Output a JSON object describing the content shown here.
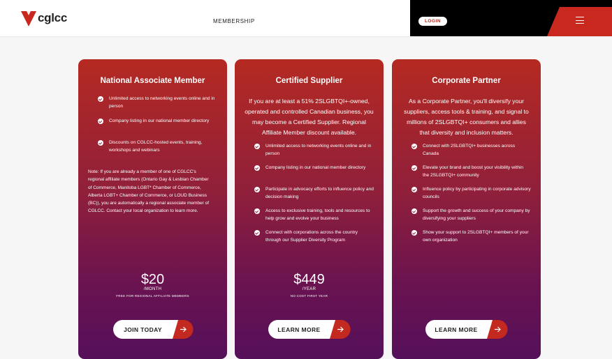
{
  "header": {
    "logo_text": "cglcc",
    "nav_membership": "MEMBERSHIP",
    "login_label": "LOGIN"
  },
  "colors": {
    "accent": "#b22a1d",
    "card_top": "#b52a22",
    "card_bottom": "#55105a"
  },
  "cards": [
    {
      "title": "National Associate Member",
      "features": [
        "Unlimited access to networking events online and in person",
        "Company listing in our national member directory",
        "Discounts on CGLCC-hosted events, training, workshops and webinars"
      ],
      "note": "Note: If you are already a member of one of CGLCC's regional affiliate members (Ontario Gay & Lesbian Chamber of Commerce, Manitoba LGBT* Chamber of Commerce, Alberta LGBT+ Chamber of Commerce, or LOUD Business (BC)), you are automatically a regional associate member of CGLCC. Contact your local organization to learn more.",
      "price": "$20",
      "period": "/MONTH",
      "price_note": "FREE FOR REGIONAL AFFILIATE MEMBERS",
      "cta": "JOIN TODAY"
    },
    {
      "title": "Certified Supplier",
      "intro": "If you are at least a 51% 2SLGBTQI+-owned, operated and controlled Canadian business, you may become a Certified Supplier. Regional Affiliate Member discount available.",
      "features": [
        "Unlimited access to networking events online and in person",
        "Company listing in our national member directory",
        "Participate in advocacy efforts to influence policy and decision making",
        "Access to exclusive training, tools and resources to help grow and evolve your business",
        "Connect with corporations across the country through our Supplier Diversity Program"
      ],
      "price": "$449",
      "period": "/YEAR",
      "price_note": "NO COST FIRST YEAR",
      "cta": "LEARN MORE"
    },
    {
      "title": "Corporate Partner",
      "intro": "As a Corporate Partner, you'll diversify your suppliers, access tools & training, and signal to millions of 2SLGBTQI+ consumers and allies that diversity and inclusion matters.",
      "features": [
        "Connect with 2SLGBTQI+ businesses across Canada",
        "Elevate your brand and boost your visibility within the 2SLGBTQI+ community",
        "Influence policy by participating in corporate advisory councils",
        "Support the growth and success of your company by diversifying your suppliers",
        "Show your support to 2SLGBTQI+ members of your own organization"
      ],
      "cta": "LEARN MORE"
    }
  ]
}
